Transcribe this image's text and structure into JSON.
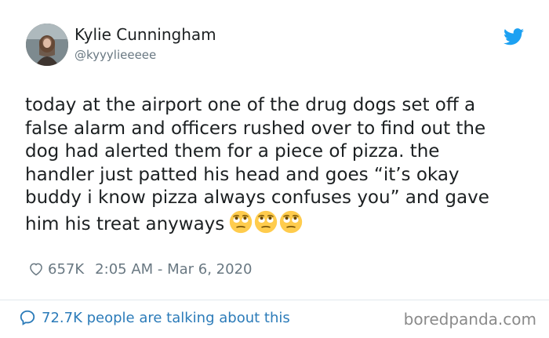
{
  "author": {
    "name": "Kylie Cunningham",
    "handle": "@kyyylieeeee",
    "avatar_icon": "profile-photo"
  },
  "brand_icon": "twitter-bird-icon",
  "colors": {
    "brand": "#1da1f2",
    "link": "#2b7bb9",
    "muted": "#697882",
    "text": "#1c2022",
    "emoji": "#ffcc4d"
  },
  "tweet": {
    "text": "today at the airport one of the drug dogs set off a\nfalse alarm and officers rushed over to find out the\ndog had alerted them for a piece of pizza. the\nhandler just patted his head and goes “it’s okay\nbuddy i know pizza always confuses you” and gave\nhim his treat anyways",
    "emojis": [
      "eye-roll-emoji",
      "eye-roll-emoji",
      "eye-roll-emoji"
    ],
    "likes": "657K",
    "timestamp": "2:05 AM - Mar 6, 2020"
  },
  "footer": {
    "talking_label": "72.7K people are talking about this",
    "watermark": "boredpanda.com"
  }
}
